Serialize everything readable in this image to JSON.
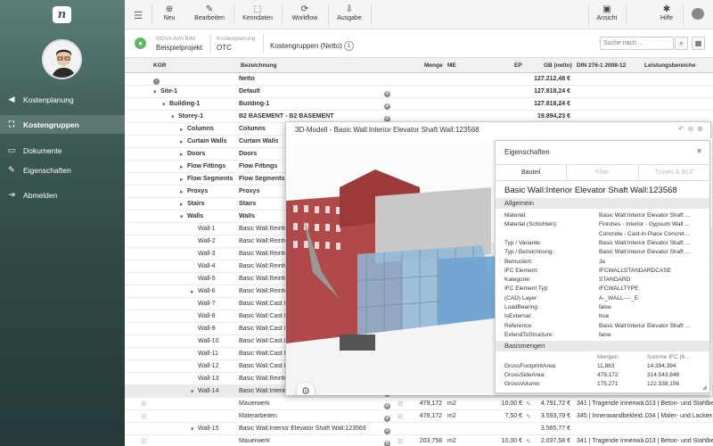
{
  "sidebar": {
    "logo": "n",
    "items": [
      {
        "label": "Kostenplanung",
        "icon": "chevron-left-icon",
        "glyph": "◀"
      },
      {
        "label": "Kostengruppen",
        "icon": "hierarchy-icon",
        "glyph": "⛶"
      },
      {
        "label": "Dokumente",
        "icon": "document-icon",
        "glyph": "▭"
      },
      {
        "label": "Eigenschaften",
        "icon": "pencil-icon",
        "glyph": "✎"
      },
      {
        "label": "Abmelden",
        "icon": "logout-icon",
        "glyph": "⇥"
      }
    ]
  },
  "toolbar": {
    "buttons": [
      {
        "label": "Neu",
        "glyph": "⊕"
      },
      {
        "label": "Bearbeiten",
        "glyph": "✎"
      },
      {
        "label": "Kenndaten",
        "glyph": "⬚"
      },
      {
        "label": "Workflow",
        "glyph": "⟳"
      },
      {
        "label": "Ausgabe",
        "glyph": "⇩"
      },
      {
        "label": "Ansicht",
        "glyph": "▣"
      },
      {
        "label": "Hilfe",
        "glyph": "✱"
      }
    ]
  },
  "infobar": {
    "org": "NOVA AVA BIM",
    "project": "Beispielprojekt",
    "kp_label": "Kostenplanung",
    "kp_value": "OTC",
    "group": "Kostengruppen (Netto)",
    "count": "1",
    "search_placeholder": "Suche nach ..."
  },
  "grid": {
    "headers": {
      "kgr": "KGR",
      "bez": "Bezeichnung",
      "menge": "Menge",
      "me": "ME",
      "ep": "EP",
      "gb": "GB (netto)",
      "din": "DIN 276-1 2008-12",
      "lb": "Leistungsbereiche"
    },
    "rows": [
      {
        "kgr": "",
        "bez": "Netto",
        "gb": "127.212,48 €",
        "level": 0,
        "nav": true,
        "bold": true
      },
      {
        "kgr": "Site-1",
        "bez": "Default",
        "gb": "127.818,24 €",
        "level": 1,
        "bold": true
      },
      {
        "kgr": "Building-1",
        "bez": "Building-1",
        "gb": "127.818,24 €",
        "level": 2,
        "bold": true
      },
      {
        "kgr": "Storey-1",
        "bez": "B2 BASEMENT - B2 BASEMENT",
        "gb": "19.894,23 €",
        "level": 3,
        "bold": true
      },
      {
        "kgr": "Columns",
        "bez": "Columns",
        "level": 4,
        "bold": true
      },
      {
        "kgr": "Curtain Walls",
        "bez": "Curtain Walls",
        "level": 4,
        "bold": true
      },
      {
        "kgr": "Doors",
        "bez": "Doors",
        "level": 4,
        "bold": true
      },
      {
        "kgr": "Flow Fittings",
        "bez": "Flow Fittings",
        "level": 4,
        "bold": true
      },
      {
        "kgr": "Flow Segments",
        "bez": "Flow Segments",
        "level": 4,
        "bold": true
      },
      {
        "kgr": "Proxys",
        "bez": "Proxys",
        "level": 4,
        "bold": true
      },
      {
        "kgr": "Stairs",
        "bez": "Stairs",
        "level": 4,
        "bold": true
      },
      {
        "kgr": "Walls",
        "bez": "Walls",
        "level": 4,
        "bold": true
      },
      {
        "kgr": "Wall-1",
        "bez": "Basic Wall:Reinforc",
        "level": 5
      },
      {
        "kgr": "Wall-2",
        "bez": "Basic Wall:Reinforc",
        "level": 5
      },
      {
        "kgr": "Wall-3",
        "bez": "Basic Wall:Reinforc",
        "level": 5
      },
      {
        "kgr": "Wall-4",
        "bez": "Basic Wall:Reinforc",
        "level": 5
      },
      {
        "kgr": "Wall-5",
        "bez": "Basic Wall:Reinforc",
        "level": 5
      },
      {
        "kgr": "Wall-6",
        "bez": "Basic Wall:Reinforc",
        "level": 5
      },
      {
        "kgr": "Wall-7",
        "bez": "Basic Wall:Cast In",
        "level": 5
      },
      {
        "kgr": "Wall-8",
        "bez": "Basic Wall:Cast In",
        "level": 5
      },
      {
        "kgr": "Wall-9",
        "bez": "Basic Wall:Cast In",
        "level": 5
      },
      {
        "kgr": "Wall-10",
        "bez": "Basic Wall:Cast In",
        "level": 5
      },
      {
        "kgr": "Wall-11",
        "bez": "Basic Wall:Cast In",
        "level": 5
      },
      {
        "kgr": "Wall-12",
        "bez": "Basic Wall:Cast In",
        "level": 5
      },
      {
        "kgr": "Wall-13",
        "bez": "Basic Wall:Reinforc",
        "level": 5
      },
      {
        "kgr": "Wall-14",
        "bez": "Basic Wall:Interior",
        "level": 5,
        "hl": true
      },
      {
        "kgr": "",
        "bez": "Mauerwerk",
        "menge": "479,172",
        "me": "m2",
        "ep": "10,00 €",
        "gb": "4.791,72 €",
        "din": "341 | Tragende Innenwä...",
        "lb": "013 | Beton- und Stahlbe..."
      },
      {
        "kgr": "",
        "bez": "Malerarbeiten",
        "menge": "479,172",
        "me": "m2",
        "ep": "7,50 €",
        "gb": "3.593,79 €",
        "din": "345 | Innenwandbekleid...",
        "lb": "034 | Maler- und Lackier..."
      },
      {
        "kgr": "Wall-15",
        "bez": "Basic Wall:Interior Elevator Shaft Wall:123569",
        "gb": "3.565,77 €",
        "level": 5
      },
      {
        "kgr": "",
        "bez": "Mauerwerk",
        "menge": "203,758",
        "me": "m2",
        "ep": "10,00 €",
        "gb": "2.037,58 €",
        "din": "341 | Tragende Innenwä...",
        "lb": "013 | Beton- und Stahlbe..."
      }
    ]
  },
  "modal": {
    "title": "3D-Modell - Basic Wall:Interior Elevator Shaft Wall:123568",
    "props": {
      "title": "Eigenschaften",
      "tabs": [
        "Bauteil",
        "Filter",
        "Tickets & BCF"
      ],
      "heading": "Basic Wall:Interior Elevator Shaft Wall:123568",
      "section1": "Allgemein",
      "rows": [
        {
          "k": "Material:",
          "v": "Basic Wall:Interior Elevator Shaft ..."
        },
        {
          "k": "Material (Schichten):",
          "v": "Finishes - Interior - Gypsum Wall ..."
        },
        {
          "k": "",
          "v": "Concrete - Cast-in-Place Concret..."
        },
        {
          "k": "Typ / Variante:",
          "v": "Basic Wall:Interior Elevator Shaft ..."
        },
        {
          "k": "Typ / Bezeichnung:",
          "v": "Basic Wall:Interior Elevator Shaft ..."
        },
        {
          "k": "Bemustert:",
          "v": "Ja"
        },
        {
          "k": "IFC Element:",
          "v": "IFCWALLSTANDARDCASE"
        },
        {
          "k": "Kategorie:",
          "v": "STANDARD"
        },
        {
          "k": "IFC Element Typ:",
          "v": "IFCWALLTYPE"
        },
        {
          "k": "(CAD) Layer:",
          "v": "A-_WALL----_E"
        },
        {
          "k": "LoadBearing:",
          "v": "false"
        },
        {
          "k": "IsExternal:",
          "v": "true"
        },
        {
          "k": "Reference:",
          "v": "Basic Wall:Interior Elevator Shaft ..."
        },
        {
          "k": "ExtendToStructure:",
          "v": "false"
        }
      ],
      "section2": "Basismengen",
      "bm_head": {
        "mengen": "Mengen",
        "summe": "Summe IFC (6..."
      },
      "bm_rows": [
        {
          "k": "GrossFootprintArea:",
          "m": "11,883",
          "s": "14.394,394"
        },
        {
          "k": "GrossSideArea:",
          "m": "479,172",
          "s": "314.543,848"
        },
        {
          "k": "GrossVolume:",
          "m": "175,271",
          "s": "122.338,156"
        }
      ]
    }
  },
  "colors": {
    "accent": "#5cb85c",
    "sidebar": "#2f4843"
  }
}
